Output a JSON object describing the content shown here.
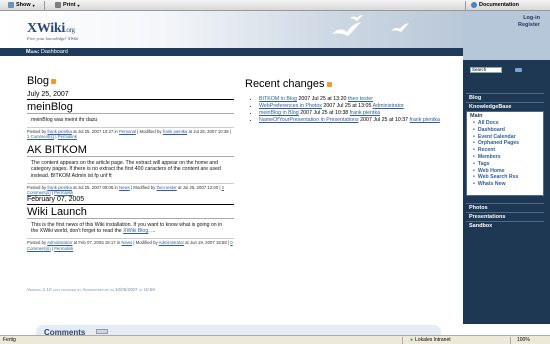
{
  "toolbar": {
    "show_label": "Show",
    "print_label": "Print",
    "documentation_label": "Documentation"
  },
  "header": {
    "logo_text": "XWiki",
    "logo_suffix": ".org",
    "tagline": "Free your knowledge! XWiki"
  },
  "login": {
    "login_label": "Log-in",
    "register_label": "Register"
  },
  "breadcrumb": {
    "space": "Main",
    "separator": ":",
    "page": "Dashboard"
  },
  "search": {
    "value": "Search"
  },
  "nav": {
    "blog": "Blog",
    "knowledgebase": "KnowledgeBase",
    "main": "Main",
    "main_items": [
      "All Docs",
      "Dashboard",
      "Event Calendar",
      "Orphaned Pages",
      "Recent",
      "Members",
      "Tags",
      "Web Home",
      "Web Search Rss",
      "Whats New"
    ],
    "photos": "Photos",
    "presentations": "Presentations",
    "sandbox": "Sandbox"
  },
  "blog": {
    "heading": "Blog",
    "posts": [
      {
        "date": "July 25, 2007",
        "title": "meinBlog",
        "body": "meinBlog was meint ihr dazu",
        "meta_prefix": "Posted by",
        "author": "frank pientka",
        "meta_at": "at Jul 25, 2007 10:27 in",
        "category": "Personal",
        "modified_by": "| Modified by",
        "modifier": "frank pientka",
        "modified_at": "at Jul 25, 2007 10:38 |",
        "comments": "1 Comment(s)",
        "pipe": "|",
        "permalink": "Permalink"
      },
      {
        "date": "",
        "title": "AK BITKOM",
        "body": "The content appears on the article page. The extract will appear on the home and category pages. If there is no extract the first 400 caracters of the content are used instead. BITKOM Admin ist fp unf ft",
        "meta_prefix": "Posted by",
        "author": "frank pientka",
        "meta_at": "at Jul 25, 2007 09:06 in",
        "category": "News",
        "modified_by": "| Modified by",
        "modifier": "theo tester",
        "modified_at": "at Jul 25, 2007 12:00 |",
        "comments": "2 Comment(s)",
        "pipe": "|",
        "permalink": "Permalink"
      },
      {
        "date": "February 07, 2005",
        "title": "Wiki Launch",
        "body": "This is the first news of this Wiki installation. If you want to know what is going on in the XWiki world, don't forget to read the",
        "body_link": "XWiki Blog",
        "body_end": ". ...",
        "meta_prefix": "Posted by",
        "author": "Administrator",
        "meta_at": "at Feb 07, 2005 19:17 in",
        "category": "News",
        "modified_by": "| Modified by",
        "modifier": "Administrator",
        "modified_at": "at Jun 19, 2007 18:58 |",
        "comments": "0 Comment(s)",
        "pipe": "|",
        "permalink": "Permalink"
      }
    ]
  },
  "recent": {
    "heading": "Recent changes",
    "items": [
      {
        "page": "BITKOM in Blog",
        "when": "2007 Jul 25 at 13:20",
        "user": "theo tester"
      },
      {
        "page": "WebPreferences in Photos",
        "when": "2007 Jul 25 at 13:05",
        "user": "Administrator"
      },
      {
        "page": "meinBlog in Blog",
        "when": "2007 Jul 25 at 10:38",
        "user": "frank pientka"
      },
      {
        "page": "NameOfYourPresentation in Presentations",
        "when": "2007 Jul 25 at 10:37",
        "user": "frank pientka"
      }
    ]
  },
  "footer": {
    "version_text": "Version 1.10 last modified by Administrator on 10/06/2007 at 18:58"
  },
  "comments_title": "Comments",
  "statusbar": {
    "left": "Fertig",
    "zone": "Lokales Intranet",
    "zoom": "100%"
  },
  "colors": {
    "nav_bg": "#1e3854",
    "link": "#2f5fa0",
    "header_blue": "#b7c7da"
  }
}
